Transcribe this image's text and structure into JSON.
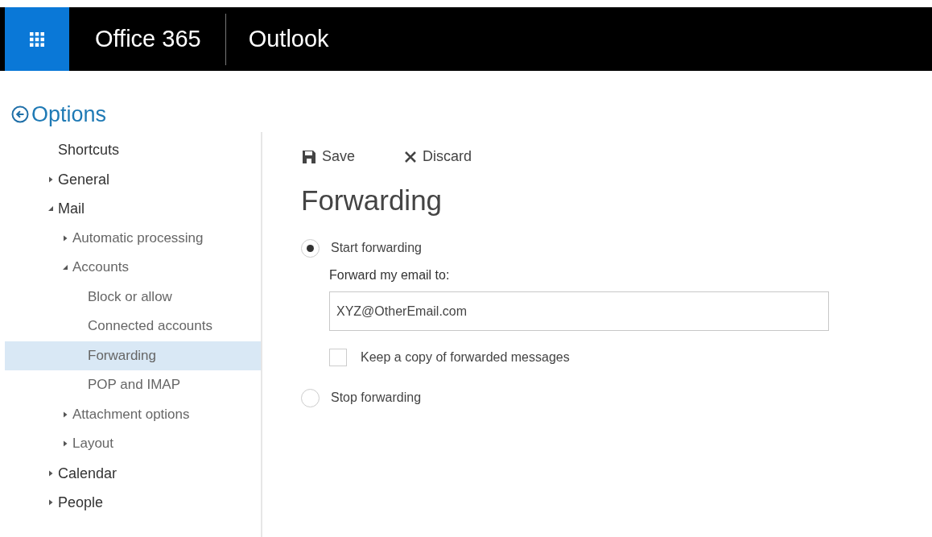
{
  "header": {
    "suite": "Office 365",
    "app": "Outlook"
  },
  "options": {
    "title": "Options"
  },
  "sidebar": {
    "items": [
      {
        "label": "Shortcuts",
        "selected": false
      },
      {
        "label": "General",
        "expanded": false,
        "selected": false
      },
      {
        "label": "Mail",
        "expanded": true,
        "selected": false,
        "children": [
          {
            "label": "Automatic processing",
            "expanded": false,
            "selected": false
          },
          {
            "label": "Accounts",
            "expanded": true,
            "selected": false,
            "children": [
              {
                "label": "Block or allow",
                "selected": false
              },
              {
                "label": "Connected accounts",
                "selected": false
              },
              {
                "label": "Forwarding",
                "selected": true
              },
              {
                "label": "POP and IMAP",
                "selected": false
              }
            ]
          },
          {
            "label": "Attachment options",
            "expanded": false,
            "selected": false
          },
          {
            "label": "Layout",
            "expanded": false,
            "selected": false
          }
        ]
      },
      {
        "label": "Calendar",
        "expanded": false,
        "selected": false
      },
      {
        "label": "People",
        "expanded": false,
        "selected": false
      }
    ]
  },
  "toolbar": {
    "buttons": [
      {
        "label": "Save",
        "kind": "save"
      },
      {
        "label": "Discard",
        "kind": "discard"
      }
    ]
  },
  "page": {
    "heading": "Forwarding",
    "choices": [
      {
        "label": "Start forwarding",
        "selected": true
      },
      {
        "label": "Stop forwarding",
        "selected": false
      }
    ],
    "forward_label": "Forward my email to:",
    "forward_value": "XYZ@OtherEmail.com",
    "keep_copy": {
      "label": "Keep a copy of forwarded messages",
      "checked": false
    }
  }
}
